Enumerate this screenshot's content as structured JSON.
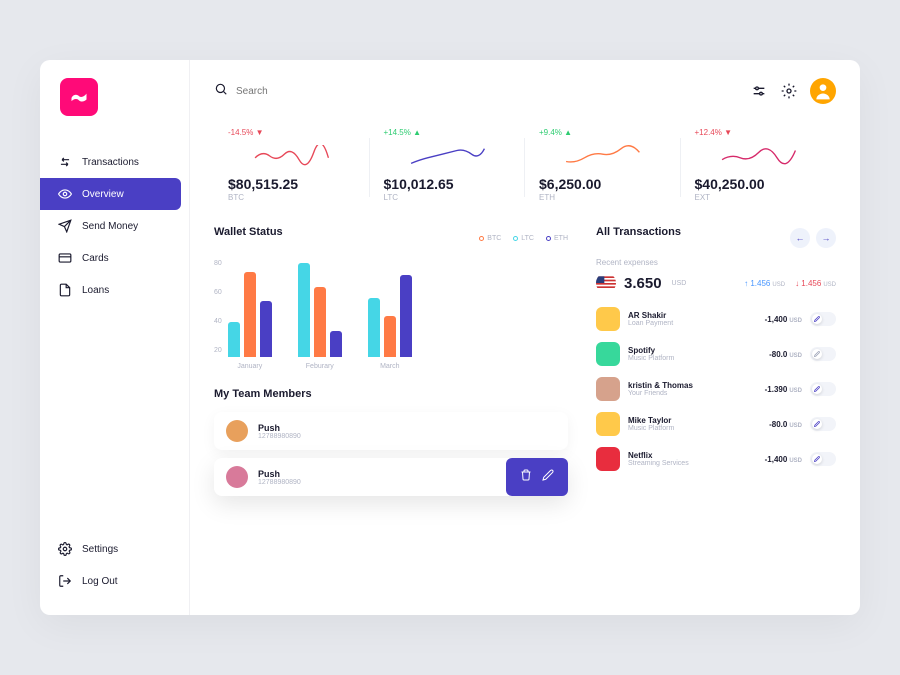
{
  "search": {
    "placeholder": "Search"
  },
  "sidebar": {
    "items": [
      {
        "label": "Transactions"
      },
      {
        "label": "Overview"
      },
      {
        "label": "Send Money"
      },
      {
        "label": "Cards"
      },
      {
        "label": "Loans"
      }
    ],
    "bottom": [
      {
        "label": "Settings"
      },
      {
        "label": "Log Out"
      }
    ]
  },
  "stats": [
    {
      "change": "-14.5%",
      "dir": "down",
      "value": "$80,515.25",
      "label": "BTC",
      "color": "#e74858"
    },
    {
      "change": "+14.5%",
      "dir": "up",
      "value": "$10,012.65",
      "label": "LTC",
      "color": "#4a3fc4"
    },
    {
      "change": "+9.4%",
      "dir": "up",
      "value": "$6,250.00",
      "label": "ETH",
      "color": "#ff7a45"
    },
    {
      "change": "+12.4%",
      "dir": "down",
      "value": "$40,250.00",
      "label": "EXT",
      "color": "#d62a6a"
    }
  ],
  "wallet": {
    "title": "Wallet Status",
    "legend": [
      {
        "label": "BTC",
        "color": "#ff7a45"
      },
      {
        "label": "LTC",
        "color": "#45d6e6"
      },
      {
        "label": "ETH",
        "color": "#4a3fc4"
      }
    ],
    "ylabels": [
      "80",
      "60",
      "40",
      "20"
    ]
  },
  "chart_data": {
    "type": "bar",
    "title": "Wallet Status",
    "categories": [
      "January",
      "Feburary",
      "March"
    ],
    "series": [
      {
        "name": "LTC",
        "color": "#45d6e6",
        "values": [
          30,
          80,
          50
        ]
      },
      {
        "name": "BTC",
        "color": "#ff7a45",
        "values": [
          72,
          60,
          35
        ]
      },
      {
        "name": "ETH",
        "color": "#4a3fc4",
        "values": [
          48,
          22,
          70
        ]
      }
    ],
    "ylim": [
      0,
      80
    ]
  },
  "team": {
    "title": "My Team Members",
    "members": [
      {
        "name": "Push",
        "sub": "12788980890",
        "avatar_bg": "#e8a05c"
      },
      {
        "name": "Push",
        "sub": "12788980890",
        "avatar_bg": "#d87a9a"
      }
    ]
  },
  "transactions": {
    "title": "All Transactions",
    "recent_label": "Recent expenses",
    "summary": {
      "value": "3.650",
      "currency": "USD",
      "up": "1.456",
      "down": "1.456"
    },
    "items": [
      {
        "name": "AR Shakir",
        "sub": "Loan Payment",
        "amount": "-1,400",
        "currency": "USD",
        "avatar_bg": "#ffc94a",
        "toggle_color": "#4a3fc4"
      },
      {
        "name": "Spotify",
        "sub": "Music Platform",
        "amount": "-80.0",
        "currency": "USD",
        "avatar_bg": "#37d89b",
        "toggle_color": "#9aa0b5"
      },
      {
        "name": "kristin & Thomas",
        "sub": "Your Friends",
        "amount": "-1.390",
        "currency": "USD",
        "avatar_bg": "#d6a28c",
        "toggle_color": "#4a3fc4"
      },
      {
        "name": "Mike Taylor",
        "sub": "Music Platform",
        "amount": "-80.0",
        "currency": "USD",
        "avatar_bg": "#ffc94a",
        "toggle_color": "#4a3fc4"
      },
      {
        "name": "Netflix",
        "sub": "Streaming Services",
        "amount": "-1,400",
        "currency": "USD",
        "avatar_bg": "#e82d3e",
        "toggle_color": "#4a3fc4"
      }
    ]
  }
}
